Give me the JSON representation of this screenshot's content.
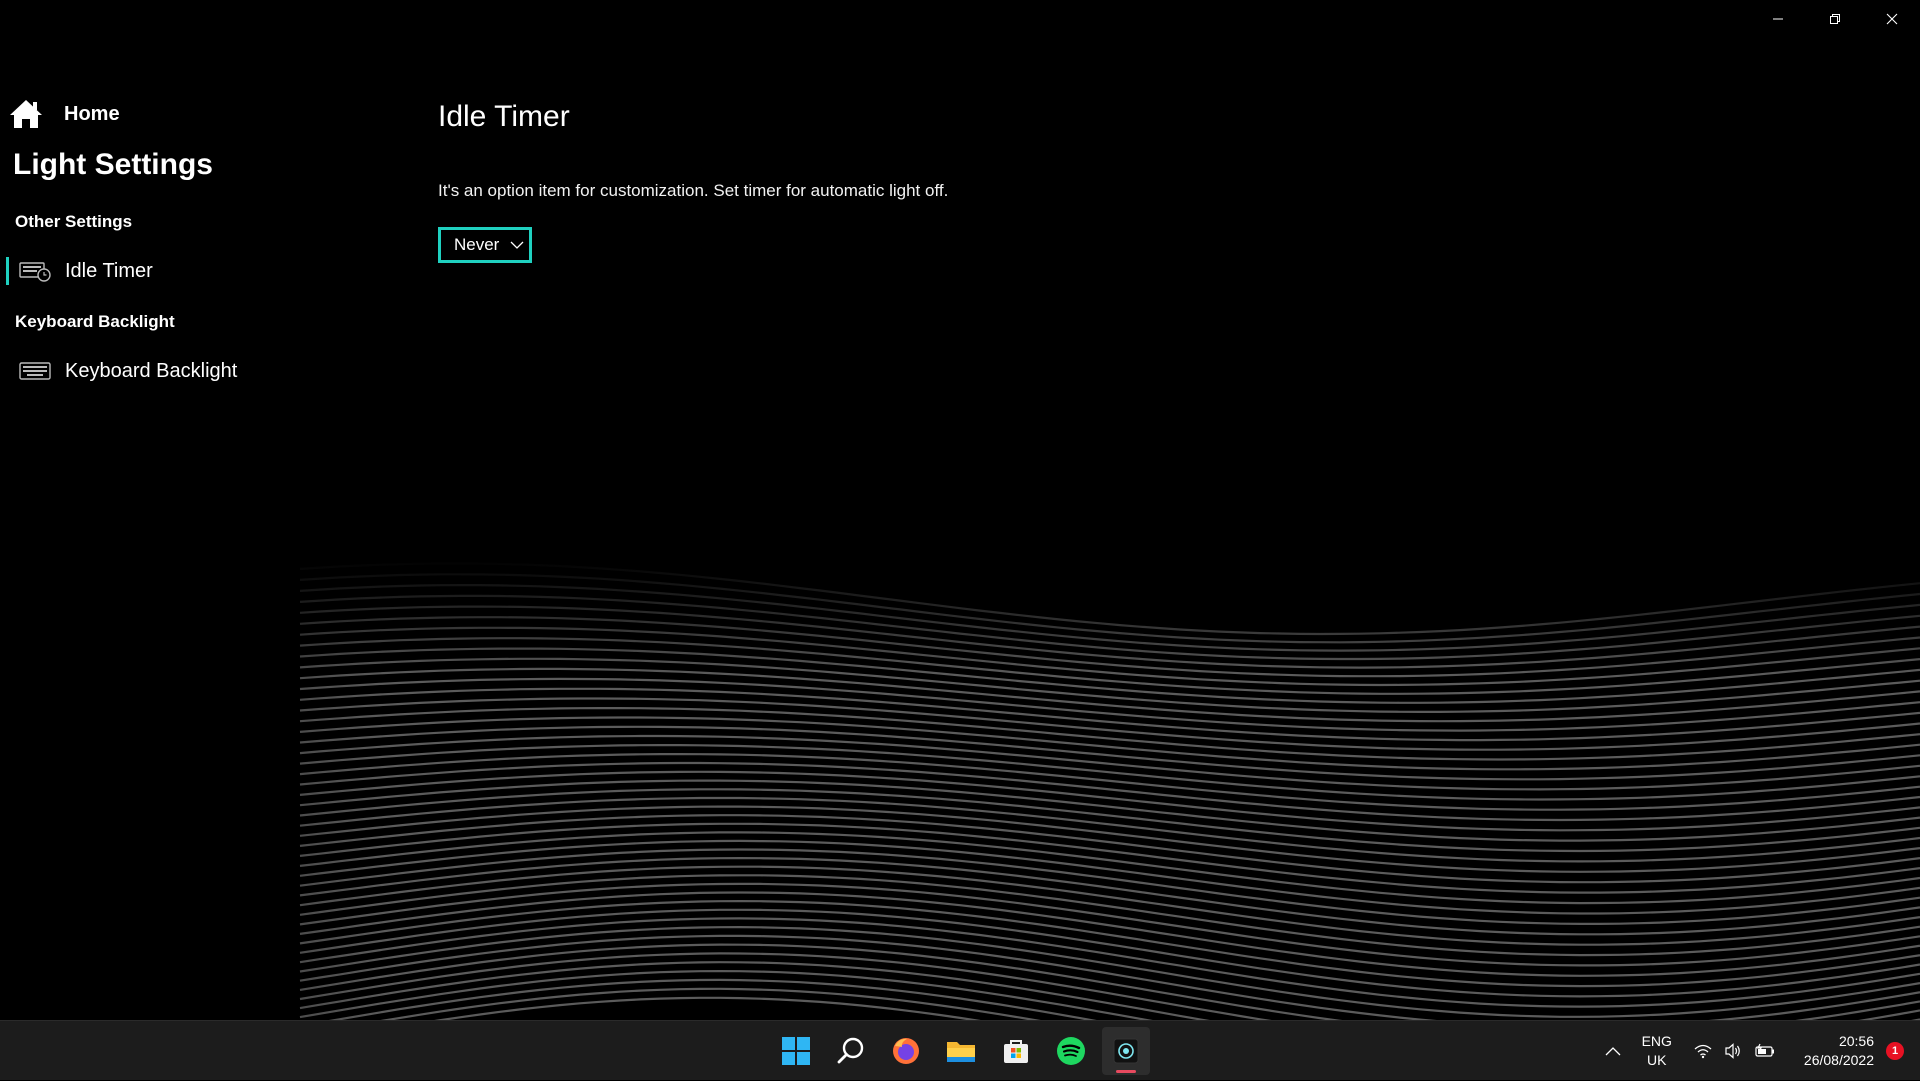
{
  "window": {
    "controls": [
      "minimize",
      "restore",
      "close"
    ]
  },
  "sidebar": {
    "home_label": "Home",
    "title": "Light Settings",
    "sections": [
      {
        "heading": "Other Settings",
        "items": [
          {
            "label": "Idle Timer",
            "icon": "idle-timer-icon",
            "active": true
          }
        ]
      },
      {
        "heading": "Keyboard Backlight",
        "items": [
          {
            "label": "Keyboard Backlight",
            "icon": "keyboard-icon",
            "active": false
          }
        ]
      }
    ]
  },
  "main": {
    "title": "Idle Timer",
    "description": "It's an option item for customization. Set timer for automatic light off.",
    "dropdown": {
      "value": "Never"
    }
  },
  "taskbar": {
    "apps": [
      "windows-start-icon",
      "search-icon",
      "firefox-icon",
      "file-explorer-icon",
      "microsoft-store-icon",
      "spotify-icon",
      "lighting-app-icon"
    ],
    "language": {
      "line1": "ENG",
      "line2": "UK"
    },
    "clock": {
      "time": "20:56",
      "date": "26/08/2022"
    },
    "notification_count": "1"
  },
  "colors": {
    "accent": "#1fd1c0",
    "background": "#000000",
    "taskbar": "#1c1c1c",
    "badge": "#e81123"
  }
}
